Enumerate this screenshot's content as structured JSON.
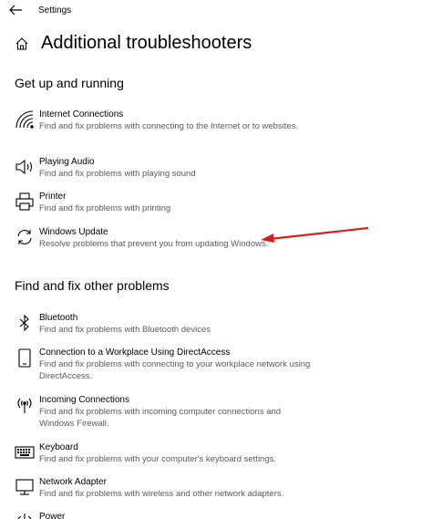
{
  "app": {
    "title": "Settings"
  },
  "page": {
    "title": "Additional troubleshooters"
  },
  "sections": {
    "get_up_running": "Get up and running",
    "find_fix_other": "Find and fix other problems"
  },
  "items": {
    "internet": {
      "title": "Internet Connections",
      "desc": "Find and fix problems with connecting to the Internet or to websites.",
      "icon": "wifi-icon"
    },
    "audio": {
      "title": "Playing Audio",
      "desc": "Find and fix problems with playing sound",
      "icon": "speaker-icon"
    },
    "printer": {
      "title": "Printer",
      "desc": "Find and fix problems with printing",
      "icon": "printer-icon"
    },
    "windows_update": {
      "title": "Windows Update",
      "desc": "Resolve problems that prevent you from updating Windows.",
      "icon": "refresh-icon"
    },
    "bluetooth": {
      "title": "Bluetooth",
      "desc": "Find and fix problems with Bluetooth devices",
      "icon": "bluetooth-icon"
    },
    "directaccess": {
      "title": "Connection to a Workplace Using DirectAccess",
      "desc": "Find and fix problems with connecting to your workplace network using DirectAccess.",
      "icon": "phone-icon"
    },
    "incoming": {
      "title": "Incoming Connections",
      "desc": "Find and fix problems with incoming computer connections and Windows Firewall.",
      "icon": "antenna-icon"
    },
    "keyboard": {
      "title": "Keyboard",
      "desc": "Find and fix problems with your computer's keyboard settings.",
      "icon": "keyboard-icon"
    },
    "network_adapter": {
      "title": "Network Adapter",
      "desc": "Find and fix problems with wireless and other network adapters.",
      "icon": "monitor-icon"
    },
    "power": {
      "title": "Power",
      "desc": "",
      "icon": "power-icon"
    }
  },
  "annotation": {
    "arrow_color": "#d42020"
  }
}
